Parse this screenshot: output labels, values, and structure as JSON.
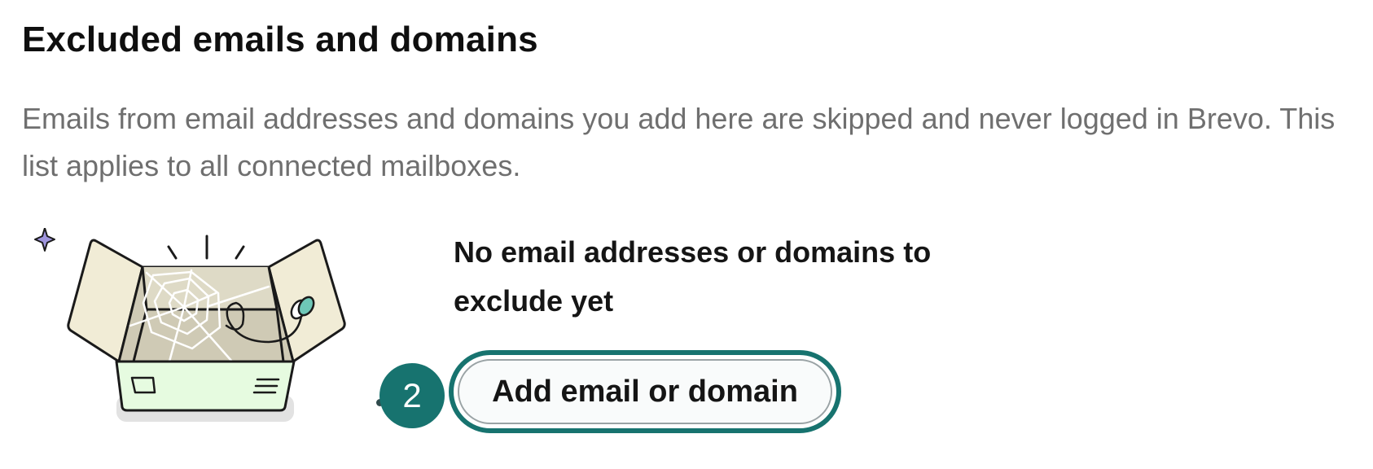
{
  "section": {
    "title": "Excluded emails and domains",
    "description": "Emails from email addresses and domains you add here are skipped and never logged in Brevo. This list applies to all connected mailboxes."
  },
  "empty_state": {
    "illustration_icon": "open-box-with-cobweb-icon",
    "heading": "No email addresses or domains to exclude yet",
    "add_button_label": "Add email or domain",
    "step_badge": "2"
  },
  "colors": {
    "accent": "#17736f",
    "title_text": "#0f0f0f",
    "description_text": "#6f6f6f",
    "box_lid": "#f1ecd6",
    "box_inside": "#cfcab5",
    "box_front": "#e6fbe0",
    "sparkle": "#9f95dd"
  }
}
